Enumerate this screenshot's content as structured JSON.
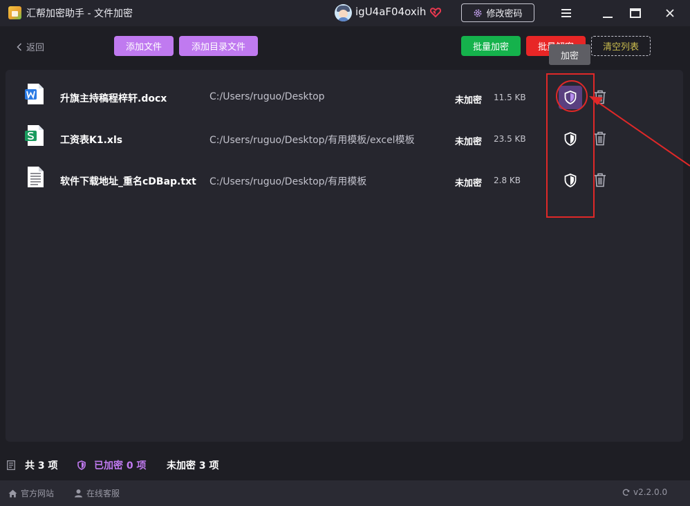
{
  "titlebar": {
    "title": "汇帮加密助手 - 文件加密",
    "username": "igU4aF04oxih",
    "change_password": "修改密码"
  },
  "toolbar": {
    "back": "返回",
    "add_file": "添加文件",
    "add_dir_file": "添加目录文件",
    "batch_encrypt": "批量加密",
    "batch_decrypt": "批量解密",
    "clear_list": "清空列表"
  },
  "tooltip": "加密",
  "files": [
    {
      "name": "升旗主持稿程梓轩.docx",
      "path": "C:/Users/ruguo/Desktop",
      "status": "未加密",
      "size": "11.5 KB",
      "type": "docx"
    },
    {
      "name": "工资表K1.xls",
      "path": "C:/Users/ruguo/Desktop/有用模板/excel模板",
      "status": "未加密",
      "size": "23.5 KB",
      "type": "xls"
    },
    {
      "name": "软件下载地址_重名cDBap.txt",
      "path": "C:/Users/ruguo/Desktop/有用模板",
      "status": "未加密",
      "size": "2.8 KB",
      "type": "txt"
    }
  ],
  "summary": {
    "total": "共 3 项",
    "encrypted": "已加密 0 项",
    "unencrypted": "未加密 3 项"
  },
  "footer": {
    "website": "官方网站",
    "service": "在线客服",
    "version": "v2.2.0.0"
  },
  "colors": {
    "accent_purple": "#c07af0",
    "green": "#15b24c",
    "red": "#e82626",
    "annotation": "#e02828"
  }
}
